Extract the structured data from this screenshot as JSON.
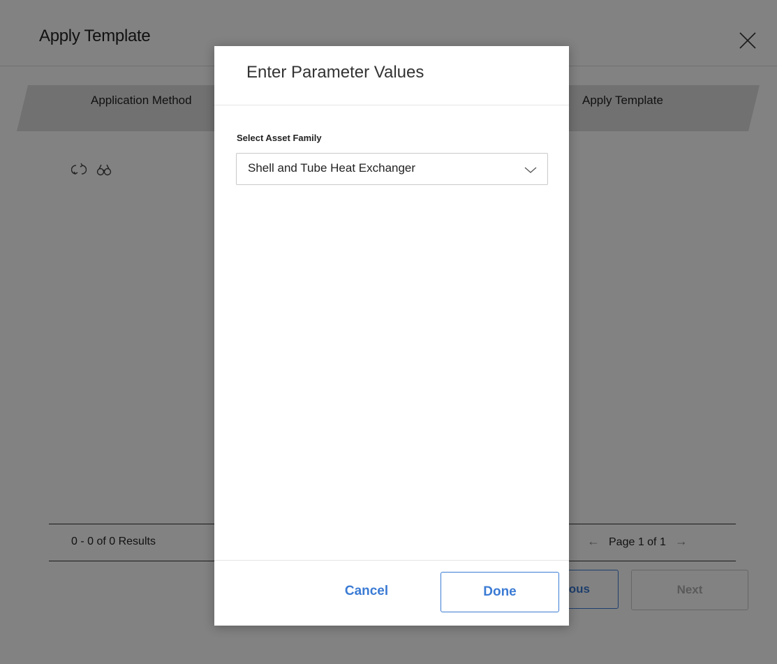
{
  "page": {
    "title": "Apply Template",
    "steps": [
      {
        "label": "Application Method"
      },
      {
        "label": "Apply Template"
      }
    ],
    "results_text": "0 - 0 of 0 Results",
    "pager": {
      "page_text": "Page 1 of 1"
    },
    "previous_button_label": "Previous",
    "previous_button_visible_label": "ous",
    "next_button_label": "Next"
  },
  "modal": {
    "title": "Enter Parameter Values",
    "field_label": "Select Asset Family",
    "select_value": "Shell and Tube Heat Exchanger",
    "cancel_label": "Cancel",
    "done_label": "Done"
  },
  "icons": [
    "close-icon",
    "refresh-icon",
    "binoculars-icon",
    "chevron-down-icon",
    "arrow-left-icon",
    "arrow-right-icon"
  ],
  "colors": {
    "accent": "#3b7bd4",
    "overlay": "rgba(0,0,0,0.49)"
  }
}
